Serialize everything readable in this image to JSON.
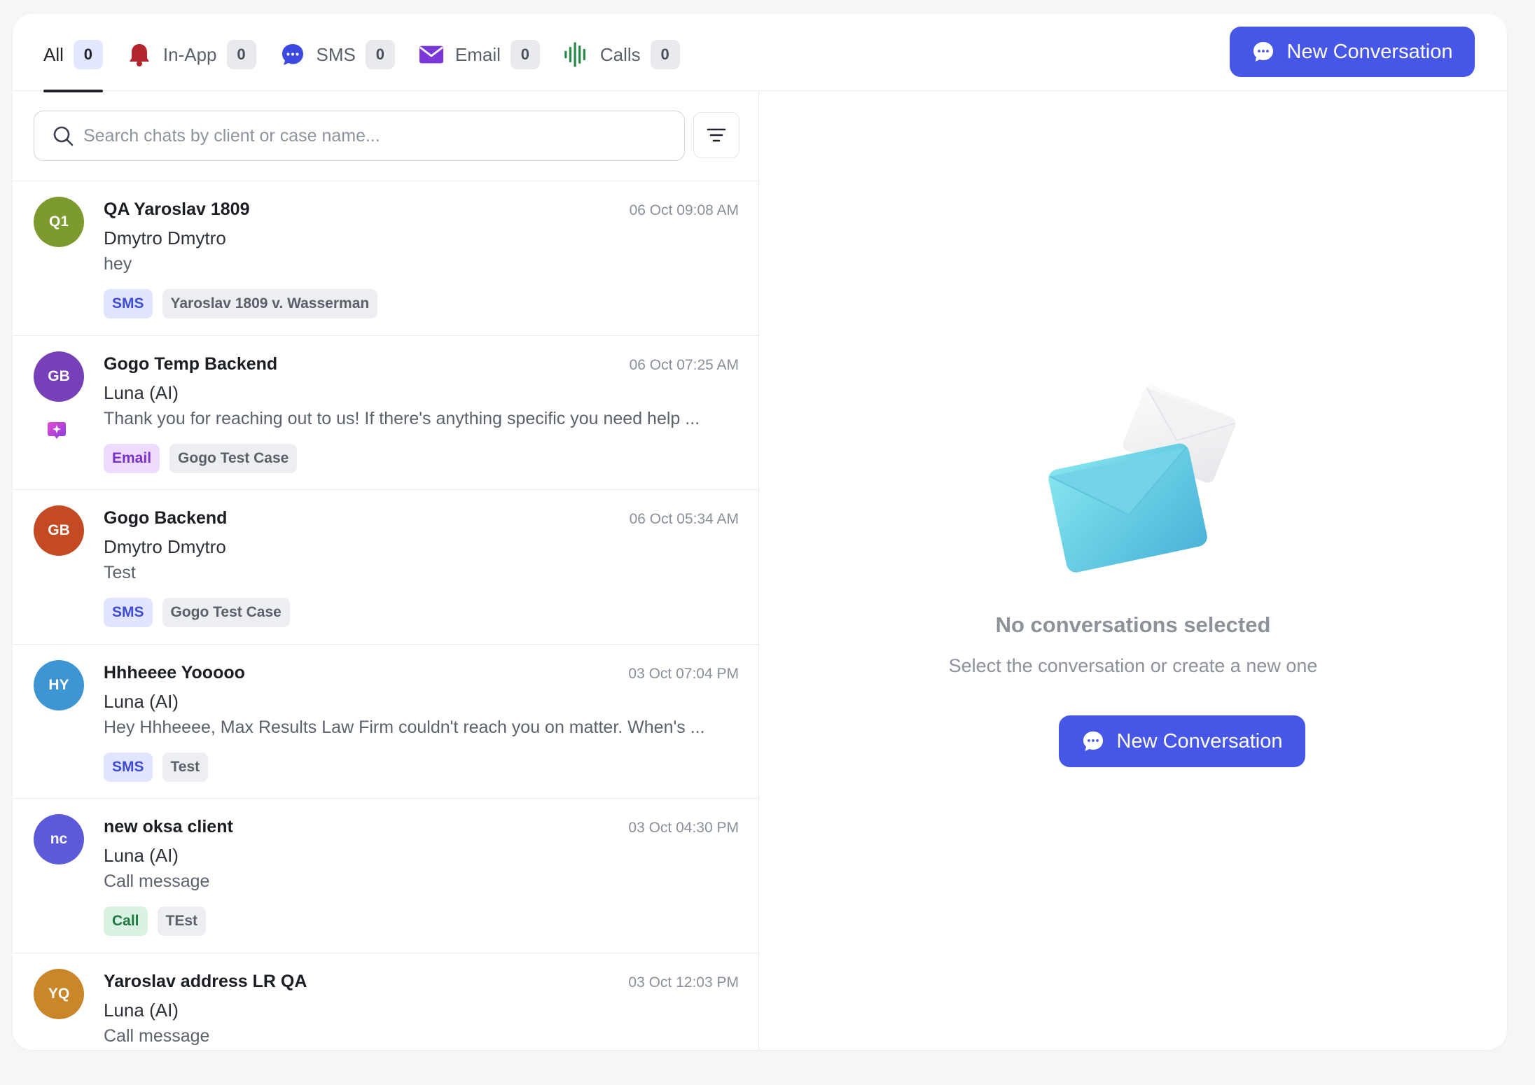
{
  "tabs": [
    {
      "label": "All",
      "count": "0",
      "icon": "none",
      "active": true
    },
    {
      "label": "In-App",
      "count": "0",
      "icon": "bell-icon",
      "color": "#b3262e"
    },
    {
      "label": "SMS",
      "count": "0",
      "icon": "chat-bubble-icon",
      "color": "#3b49df"
    },
    {
      "label": "Email",
      "count": "0",
      "icon": "envelope-icon",
      "color": "#7a36d6"
    },
    {
      "label": "Calls",
      "count": "0",
      "icon": "waveform-icon",
      "color": "#2d8a4e"
    }
  ],
  "header": {
    "new_conversation_label": "New Conversation"
  },
  "search": {
    "placeholder": "Search chats by client or case name..."
  },
  "conversations": [
    {
      "initials": "Q1",
      "avatar_color": "#7c9a2d",
      "title": "QA Yaroslav 1809",
      "time": "06 Oct 09:08 AM",
      "sender": "Dmytro Dmytro",
      "preview": "hey",
      "channel": "SMS",
      "case": "Yaroslav 1809 v. Wasserman",
      "ai": false
    },
    {
      "initials": "GB",
      "avatar_color": "#7540b8",
      "title": "Gogo Temp Backend",
      "time": "06 Oct 07:25 AM",
      "sender": "Luna (AI)",
      "preview": "Thank you for reaching out to us! If there's anything specific you need help ...",
      "channel": "Email",
      "case": "Gogo Test Case",
      "ai": true
    },
    {
      "initials": "GB",
      "avatar_color": "#c34a22",
      "title": "Gogo Backend",
      "time": "06 Oct 05:34 AM",
      "sender": "Dmytro Dmytro",
      "preview": "Test",
      "channel": "SMS",
      "case": "Gogo Test Case",
      "ai": false
    },
    {
      "initials": "HY",
      "avatar_color": "#3e95d3",
      "title": "Hhheeee Yooooo",
      "time": "03 Oct 07:04 PM",
      "sender": "Luna (AI)",
      "preview": "Hey Hhheeee, Max Results Law Firm couldn't reach you on matter. When's ...",
      "channel": "SMS",
      "case": "Test",
      "ai": false
    },
    {
      "initials": "nc",
      "avatar_color": "#5b5bd9",
      "title": "new oksa client",
      "time": "03 Oct 04:30 PM",
      "sender": "Luna (AI)",
      "preview": "Call message",
      "channel": "Call",
      "case": "TEst",
      "ai": false
    },
    {
      "initials": "YQ",
      "avatar_color": "#c9872a",
      "title": "Yaroslav address LR QA",
      "time": "03 Oct 12:03 PM",
      "sender": "Luna (AI)",
      "preview": "Call message",
      "channel": "",
      "case": "",
      "ai": false
    }
  ],
  "empty_state": {
    "title": "No conversations selected",
    "subtitle": "Select the conversation or create a new one",
    "button_label": "New Conversation"
  }
}
